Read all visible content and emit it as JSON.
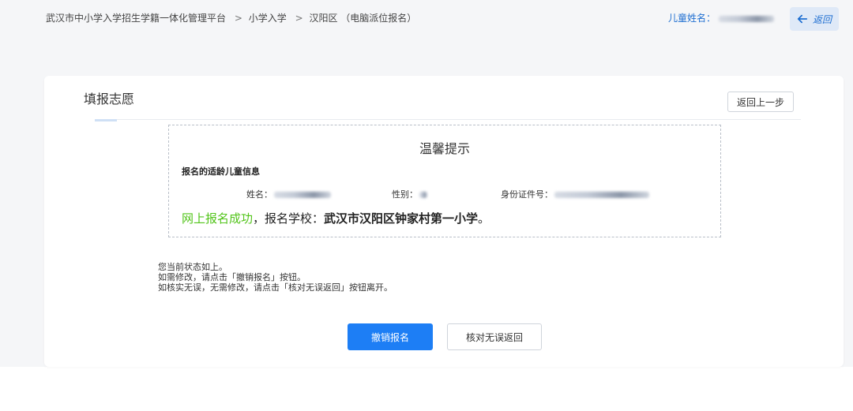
{
  "header": {
    "breadcrumb": [
      "武汉市中小学入学招生学籍一体化管理平台",
      "小学入学",
      "汉阳区 （电脑派位报名）"
    ],
    "breadcrumb_sep": ">",
    "child_name_label": "儿童姓名：",
    "back_label": "返回",
    "back_icon": "arrow-left-icon"
  },
  "card": {
    "title": "填报志愿",
    "prev_step_label": "返回上一步"
  },
  "tip": {
    "title": "温馨提示",
    "info_label": "报名的适龄儿童信息",
    "name_label": "姓名：",
    "gender_label": "性别：",
    "id_label": "身份证件号：",
    "success_text": "网上报名成功",
    "comma": "，报名学校：",
    "school": "武汉市汉阳区钟家村第一小学",
    "period": "。"
  },
  "status": {
    "line1": "您当前状态如上。",
    "line2": "如需修改，请点击「撤销报名」按钮。",
    "line3": "如核实无误，无需修改，请点击「核对无误返回」按钮离开。"
  },
  "actions": {
    "cancel_label": "撤销报名",
    "confirm_label": "核对无误返回"
  },
  "colors": {
    "accent": "#1d7ef5",
    "success": "#52c41a",
    "link": "#1f6fd1"
  }
}
